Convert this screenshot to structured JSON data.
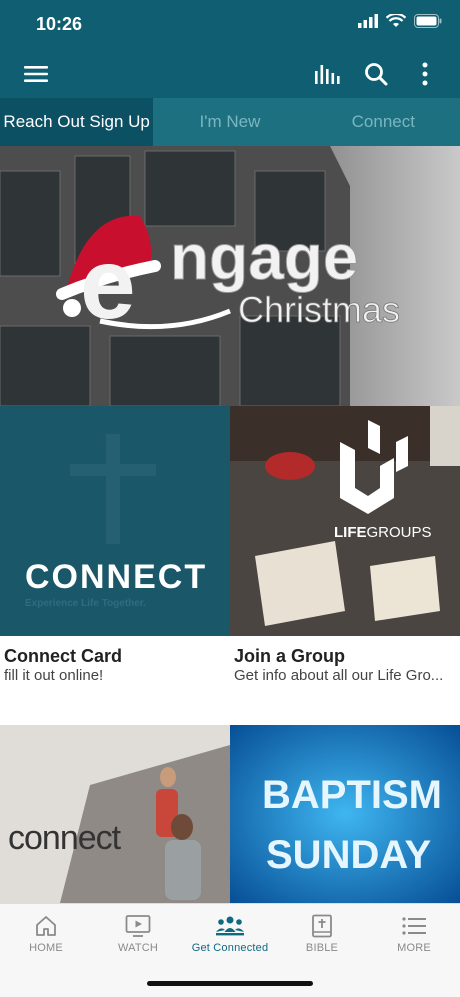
{
  "status": {
    "time": "10:26"
  },
  "tabs": [
    {
      "label": "Reach Out Sign Up",
      "active": true
    },
    {
      "label": "I'm New",
      "active": false
    },
    {
      "label": "Connect",
      "active": false
    }
  ],
  "hero": {
    "title_word": "ngage",
    "subtitle_word": "Christmas",
    "initial": "e"
  },
  "cards": [
    {
      "title": "Connect Card",
      "subtitle": "fill it out online!",
      "image_text": "CONNECT",
      "image_tagline": "Experience Life Together."
    },
    {
      "title": "Join a Group",
      "subtitle": "Get info about all our Life Gro...",
      "image_text_bold": "LIFE",
      "image_text": "GROUPS"
    },
    {
      "title": "",
      "subtitle": "",
      "image_text": "connect"
    },
    {
      "title": "",
      "subtitle": "",
      "image_text_line1": "BAPTISM",
      "image_text_line2": "SUNDAY"
    }
  ],
  "bottom_nav": [
    {
      "label": "HOME",
      "icon": "home-icon",
      "active": false
    },
    {
      "label": "WATCH",
      "icon": "tv-icon",
      "active": false
    },
    {
      "label": "Get Connected",
      "icon": "people-icon",
      "active": true
    },
    {
      "label": "BIBLE",
      "icon": "bible-icon",
      "active": false
    },
    {
      "label": "MORE",
      "icon": "list-icon",
      "active": false
    }
  ],
  "colors": {
    "primary": "#0f5e72",
    "tab_bg": "#1d7080",
    "tab_active": "#0c5163",
    "nav_active": "#0f6a80",
    "santa_red": "#c8102e"
  }
}
